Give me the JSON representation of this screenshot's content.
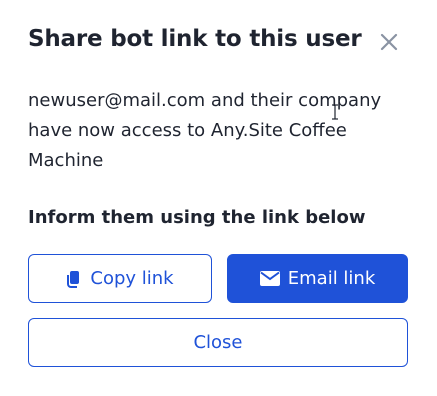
{
  "dialog": {
    "title": "Share bot link to this user",
    "message": "newuser@mail.com and their company have now access to Any.Site Coffee Machine",
    "inform_label": "Inform them using the link below",
    "copy_link_label": "Copy link",
    "email_link_label": "Email link",
    "close_label": "Close"
  },
  "icons": {
    "close": "close-icon",
    "copy": "copy-icon",
    "email": "envelope-icon"
  },
  "colors": {
    "accent": "#1f52d8",
    "text": "#1f2430",
    "close_icon": "#8a93a3"
  }
}
